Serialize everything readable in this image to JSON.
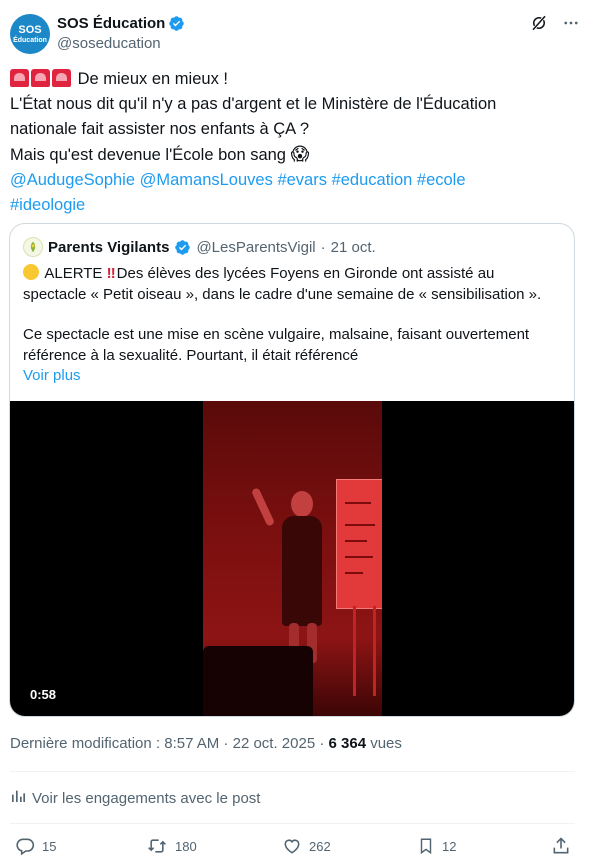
{
  "author": {
    "avatar_line1": "SOS",
    "avatar_line2": "Éducation",
    "name": "SOS Éducation",
    "handle": "@soseducation"
  },
  "tweet": {
    "line1": "De mieux en mieux !",
    "line2": "L'État nous dit qu'il n'y a pas d'argent et le Ministère de l'Éducation",
    "line3": "nationale fait assister nos enfants à ÇA ?",
    "line4": "Mais qu'est devenue l'École bon sang",
    "line4_emoji": "😱",
    "mention1": "@AudugeSophie",
    "mention2": "@MamansLouves",
    "hashtag1": "#evars",
    "hashtag2": "#education",
    "hashtag3": "#ecole",
    "hashtag4": "#ideologie"
  },
  "quote": {
    "name": "Parents Vigilants",
    "handle": "@LesParentsVigil",
    "separator": "·",
    "date": "21 oct.",
    "alert_word": "ALERTE",
    "alert_bang": "‼",
    "line1": "Des élèves des lycées Foyens en Gironde ont assisté au",
    "line2": "spectacle « Petit oiseau », dans le cadre d'une semaine de « sensibilisation ».",
    "line3": "Ce spectacle est une mise en scène vulgaire, malsaine, faisant ouvertement",
    "line4": "référence à la sexualité. Pourtant, il était référencé",
    "show_more": "Voir plus",
    "video_duration": "0:58"
  },
  "meta": {
    "modified_label": "Dernière modification : 8:57 AM · 22 oct. 2025 ·",
    "views_count": "6 364",
    "views_label": "vues"
  },
  "engagements_label": "Voir les engagements avec le post",
  "actions": {
    "replies": "15",
    "reposts": "180",
    "likes": "262",
    "bookmarks": "12"
  },
  "colors": {
    "accent": "#1d9bf0",
    "text": "#0f1419",
    "secondary": "#536471",
    "border": "#cfd9de"
  },
  "icons": [
    "verified-icon",
    "grok-icon",
    "more-icon",
    "siren-icon",
    "scream-emoji",
    "yellow-circle-icon",
    "analytics-icon",
    "reply-icon",
    "repost-icon",
    "like-icon",
    "bookmark-icon",
    "share-icon"
  ]
}
